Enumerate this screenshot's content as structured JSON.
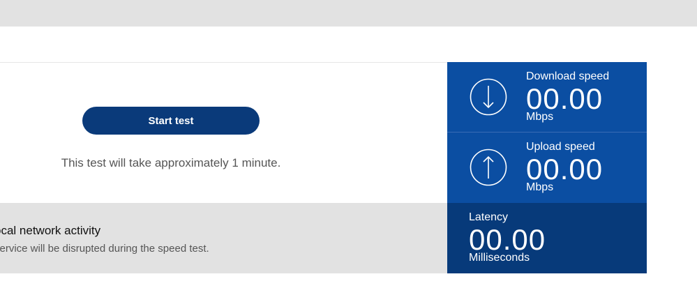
{
  "test": {
    "start_label": "Start test",
    "note": "This test will take approximately 1 minute."
  },
  "activity": {
    "title": "ocal network activity",
    "description": "service will be disrupted during the speed test."
  },
  "metrics": {
    "download": {
      "label": "Download speed",
      "value": "00.00",
      "unit": "Mbps",
      "icon": "arrow-down-circle-icon"
    },
    "upload": {
      "label": "Upload speed",
      "value": "00.00",
      "unit": "Mbps",
      "icon": "arrow-up-circle-icon"
    },
    "latency": {
      "label": "Latency",
      "value": "00.00",
      "unit": "Milliseconds"
    }
  },
  "colors": {
    "button": "#0a3a7a",
    "metric_bg": "#0b4ea2",
    "latency_bg": "#073a7a",
    "band_gray": "#e2e2e2"
  }
}
